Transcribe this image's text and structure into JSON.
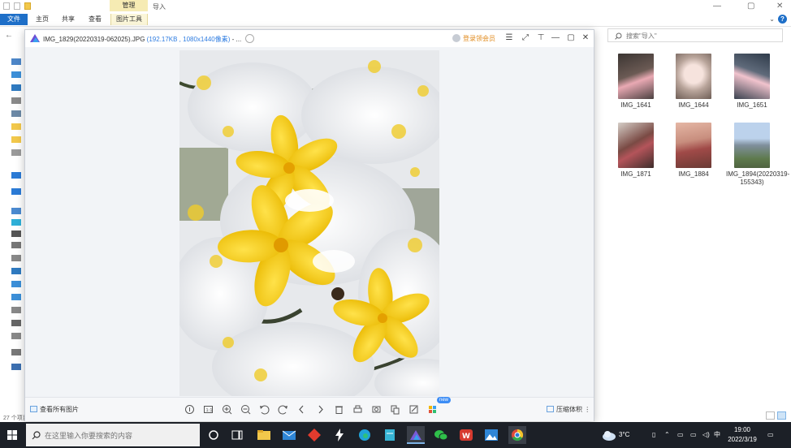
{
  "explorer": {
    "title": "导入",
    "context_tab_header": "管理",
    "ribbon_tabs": [
      "文件",
      "主页",
      "共享",
      "查看",
      "图片工具"
    ],
    "search_placeholder": "搜索\"导入\"",
    "status_text": "27 个项目",
    "thumbnails": [
      {
        "name": "IMG_1641",
        "color": "#6b5a54"
      },
      {
        "name": "IMG_1644",
        "color": "#b8a49a"
      },
      {
        "name": "IMG_1651",
        "color": "#5f6a7a"
      },
      {
        "name": "IMG_1871",
        "color": "#7a4a44"
      },
      {
        "name": "IMG_1884",
        "color": "#c88e7e"
      },
      {
        "name": "IMG_1894(20220319-155343)",
        "color": "#8fa7c2"
      }
    ]
  },
  "viewer": {
    "filename": "IMG_1829(20220319-062025).JPG",
    "file_meta": "(192.17KB , 1080x1440像素)",
    "title_suffix": " - ...",
    "login_label": "登录领会员",
    "all_pictures_label": "查看所有图片",
    "new_badge": "new",
    "compress_label": "压缩体积",
    "accent_color": "#2f7de1"
  },
  "taskbar": {
    "search_placeholder": "在这里输入你要搜索的内容",
    "weather": "3°C",
    "ime": "中",
    "time": "19:00",
    "date": "2022/3/19"
  }
}
